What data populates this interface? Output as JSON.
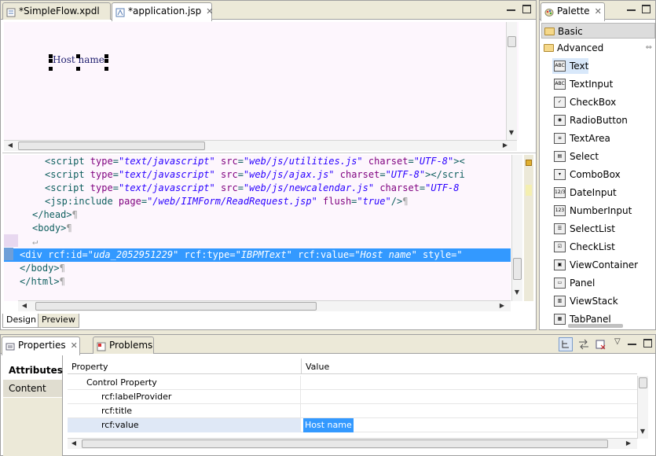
{
  "editor": {
    "tabs": [
      {
        "label": "*SimpleFlow.xpdl",
        "icon": "xpdl-file-icon"
      },
      {
        "label": "*application.jsp",
        "icon": "jsp-file-icon",
        "close": "✕"
      }
    ],
    "design_label": "Host name",
    "code_lines": [
      {
        "parts": [
          [
            "tg",
            "<script "
          ],
          [
            "at",
            "type"
          ],
          [
            "tg",
            "="
          ],
          [
            "val",
            "\"text/javascript\""
          ],
          [
            "tg",
            " "
          ],
          [
            "at",
            "src"
          ],
          [
            "tg",
            "="
          ],
          [
            "val",
            "\"web/js/utilities.js\""
          ],
          [
            "tg",
            " "
          ],
          [
            "at",
            "charset"
          ],
          [
            "tg",
            "="
          ],
          [
            "val",
            "\"UTF-8\""
          ],
          [
            "tg",
            "><"
          ]
        ]
      },
      {
        "parts": [
          [
            "tg",
            "<script "
          ],
          [
            "at",
            "type"
          ],
          [
            "tg",
            "="
          ],
          [
            "val",
            "\"text/javascript\""
          ],
          [
            "tg",
            " "
          ],
          [
            "at",
            "src"
          ],
          [
            "tg",
            "="
          ],
          [
            "val",
            "\"web/js/ajax.js\""
          ],
          [
            "tg",
            " "
          ],
          [
            "at",
            "charset"
          ],
          [
            "tg",
            "="
          ],
          [
            "val",
            "\"UTF-8\""
          ],
          [
            "tg",
            "></scri"
          ]
        ]
      },
      {
        "parts": [
          [
            "tg",
            "<script "
          ],
          [
            "at",
            "type"
          ],
          [
            "tg",
            "="
          ],
          [
            "val",
            "\"text/javascript\""
          ],
          [
            "tg",
            " "
          ],
          [
            "at",
            "src"
          ],
          [
            "tg",
            "="
          ],
          [
            "val",
            "\"web/js/newcalendar.js\""
          ],
          [
            "tg",
            " "
          ],
          [
            "at",
            "charset"
          ],
          [
            "tg",
            "="
          ],
          [
            "val",
            "\"UTF-8"
          ]
        ]
      },
      {
        "parts": [
          [
            "tg",
            "<jsp:include "
          ],
          [
            "at",
            "page"
          ],
          [
            "tg",
            "="
          ],
          [
            "val",
            "\"/web/IIMForm/ReadRequest.jsp\""
          ],
          [
            "tg",
            " "
          ],
          [
            "at",
            "flush"
          ],
          [
            "tg",
            "="
          ],
          [
            "val",
            "\"true\""
          ],
          [
            "tg",
            "/>"
          ],
          [
            "ws",
            "¶"
          ]
        ]
      },
      {
        "parts": [
          [
            "tg",
            "</head>"
          ],
          [
            "ws",
            "¶"
          ]
        ]
      },
      {
        "parts": [
          [
            "tg",
            "<body>"
          ],
          [
            "ws",
            "¶"
          ]
        ]
      },
      {
        "parts": [
          [
            "ws",
            "↵"
          ]
        ]
      },
      {
        "parts": [
          [
            "tg",
            "<div "
          ],
          [
            "at",
            "rcf:id"
          ],
          [
            "tg",
            "="
          ],
          [
            "val",
            "\"uda_2052951229\""
          ],
          [
            "tg",
            " "
          ],
          [
            "at",
            "rcf:type"
          ],
          [
            "tg",
            "="
          ],
          [
            "val",
            "\"IBPMText\""
          ],
          [
            "tg",
            " "
          ],
          [
            "at",
            "rcf:value"
          ],
          [
            "tg",
            "="
          ],
          [
            "val",
            "\"Host name\""
          ],
          [
            "tg",
            " "
          ],
          [
            "at",
            "style"
          ],
          [
            "tg",
            "=\""
          ]
        ]
      },
      {
        "parts": [
          [
            "tg",
            "</body>"
          ],
          [
            "ws",
            "¶"
          ]
        ]
      },
      {
        "parts": [
          [
            "tg",
            "</html>"
          ],
          [
            "ws",
            "¶"
          ]
        ]
      }
    ],
    "bottom_tabs": [
      "Design",
      "Preview"
    ]
  },
  "palette": {
    "title": "Palette",
    "drawers": [
      "Basic",
      "Advanced"
    ],
    "items": [
      {
        "label": "Text",
        "icon": "ABC"
      },
      {
        "label": "TextInput",
        "icon": "ABC"
      },
      {
        "label": "CheckBox",
        "icon": "✓"
      },
      {
        "label": "RadioButton",
        "icon": "◉"
      },
      {
        "label": "TextArea",
        "icon": "≡"
      },
      {
        "label": "Select",
        "icon": "▤"
      },
      {
        "label": "ComboBox",
        "icon": "▾"
      },
      {
        "label": "DateInput",
        "icon": "12/3"
      },
      {
        "label": "NumberInput",
        "icon": "123"
      },
      {
        "label": "SelectList",
        "icon": "☰"
      },
      {
        "label": "CheckList",
        "icon": "☑"
      },
      {
        "label": "ViewContainer",
        "icon": "▣"
      },
      {
        "label": "Panel",
        "icon": "▭"
      },
      {
        "label": "ViewStack",
        "icon": "▥"
      },
      {
        "label": "TabPanel",
        "icon": "▦"
      }
    ]
  },
  "properties": {
    "tabs": [
      {
        "label": "Properties",
        "close": "✕"
      },
      {
        "label": "Problems"
      }
    ],
    "side_tabs": [
      "Attributes",
      "Content"
    ],
    "headers": [
      "Property",
      "Value"
    ],
    "rows": [
      {
        "property": "Control Property",
        "value": ""
      },
      {
        "property": "rcf:labelProvider",
        "value": ""
      },
      {
        "property": "rcf:title",
        "value": ""
      },
      {
        "property": "rcf:value",
        "value": "Host name"
      }
    ]
  }
}
